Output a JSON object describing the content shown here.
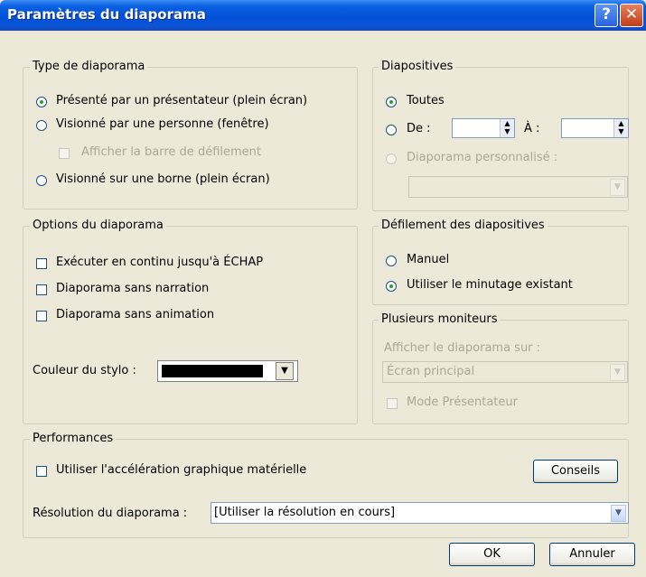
{
  "window": {
    "title": "Paramètres du diaporama",
    "help_glyph": "?",
    "close_glyph": "✕"
  },
  "type_diaporama": {
    "legend": "Type de diaporama",
    "options": [
      {
        "label": "Présenté par un présentateur (plein écran)",
        "selected": true
      },
      {
        "label": "Visionné par une personne (fenêtre)",
        "selected": false
      },
      {
        "label": "Visionné sur une borne (plein écran)",
        "selected": false
      }
    ],
    "scrollbar_check": {
      "label": "Afficher la barre de défilement",
      "checked": false,
      "disabled": true
    }
  },
  "diapositives": {
    "legend": "Diapositives",
    "all_label": "Toutes",
    "from_label": "De :",
    "to_label": "À :",
    "from_value": "",
    "to_value": "",
    "custom_label": "Diaporama personnalisé :",
    "custom_value": ""
  },
  "options_diaporama": {
    "legend": "Options du diaporama",
    "checks": [
      {
        "label": "Exécuter en continu jusqu'à ÉCHAP",
        "checked": false
      },
      {
        "label": "Diaporama sans narration",
        "checked": false
      },
      {
        "label": "Diaporama sans animation",
        "checked": false
      }
    ],
    "pen_color_label": "Couleur du stylo :",
    "pen_color": "#000000"
  },
  "defilement": {
    "legend": "Défilement des diapositives",
    "manual_label": "Manuel",
    "timing_label": "Utiliser le minutage existant"
  },
  "moniteurs": {
    "legend": "Plusieurs moniteurs",
    "show_on_label": "Afficher le diaporama sur :",
    "monitor_value": "Écran principal",
    "presenter_mode_label": "Mode Présentateur"
  },
  "performances": {
    "legend": "Performances",
    "hw_accel_label": "Utiliser l'accélération graphique matérielle",
    "tips_button": "Conseils",
    "resolution_label": "Résolution du diaporama :",
    "resolution_value": "[Utiliser la résolution en cours]"
  },
  "footer": {
    "ok_label": "OK",
    "cancel_label": "Annuler"
  },
  "colors": {
    "titlebar": "#0a5fe0",
    "dialog_bg": "#ece9d8",
    "radio_dot": "#21a121"
  }
}
